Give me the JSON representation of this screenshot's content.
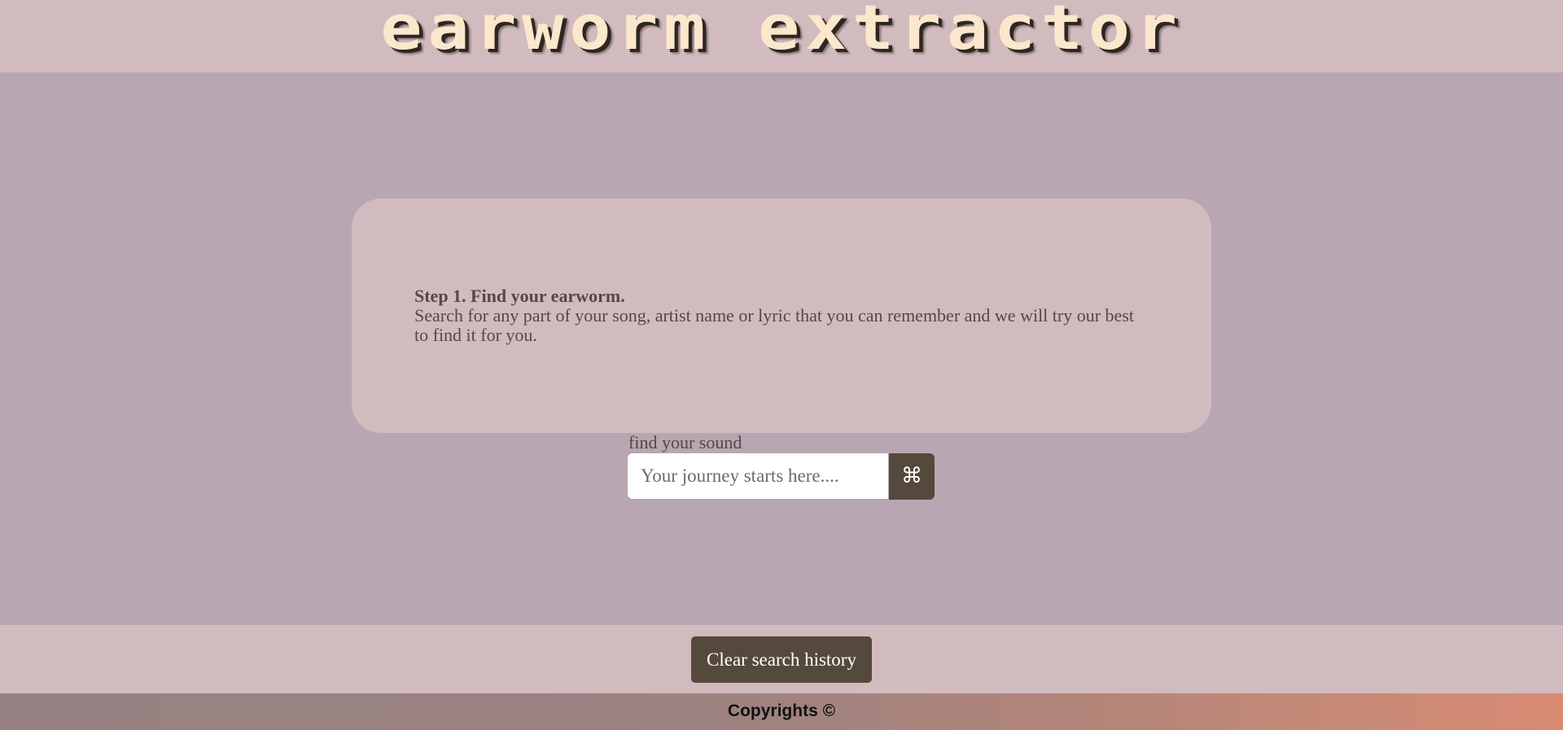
{
  "header": {
    "title": "earworm extractor"
  },
  "step_card": {
    "title": "Step 1. Find your earworm.",
    "description": "Search for any part of your song, artist name or lyric that you can remember and we will try our best to find it for you."
  },
  "search": {
    "label": "find your sound",
    "placeholder": "Your journey starts here....",
    "value": "",
    "button_icon": "command-icon",
    "button_glyph": "⌘"
  },
  "actions": {
    "clear_history_label": "Clear search history"
  },
  "footer": {
    "copyright": "Copyrights ©"
  },
  "colors": {
    "header_bg": "#d2bbbe",
    "main_bg": "#b8a7b2",
    "button_bg": "#55493d",
    "title_color": "#fbe7cc",
    "text_color": "#57483f"
  }
}
